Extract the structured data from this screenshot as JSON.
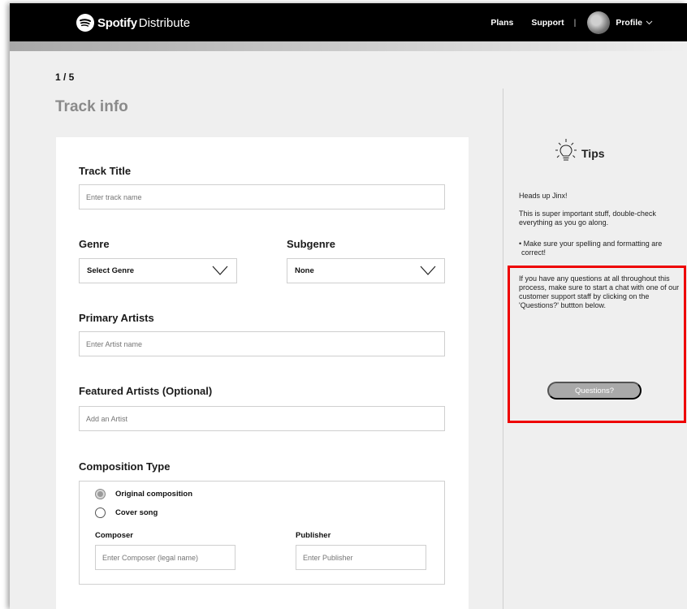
{
  "header": {
    "brand": "Spotify",
    "product": "Distribute",
    "nav": {
      "plans": "Plans",
      "support": "Support",
      "separator": "|",
      "profile": "Profile"
    }
  },
  "progress": {
    "fraction": 0.2
  },
  "step": "1 / 5",
  "page_title": "Track info",
  "form": {
    "track_title": {
      "label": "Track Title",
      "placeholder": "Enter track name"
    },
    "genre": {
      "label": "Genre",
      "value": "Select Genre"
    },
    "subgenre": {
      "label": "Subgenre",
      "value": "None"
    },
    "primary_artists": {
      "label": "Primary Artists",
      "placeholder": "Enter Artist name"
    },
    "featured_artists": {
      "label": "Featured Artists (Optional)",
      "placeholder": "Add an Artist"
    },
    "composition": {
      "label": "Composition Type",
      "options": [
        "Original composition",
        "Cover song"
      ],
      "selected": "Original composition",
      "composer": {
        "label": "Composer",
        "placeholder": "Enter Composer (legal name)"
      },
      "publisher": {
        "label": "Publisher",
        "placeholder": "Enter Publisher"
      }
    }
  },
  "tips": {
    "title": "Tips",
    "greeting": "Heads up Jinx!",
    "intro": "This is super important stuff, double-check everything as you go along.",
    "bullet": "• Make sure your spelling and formatting are correct!",
    "questions_text": "If you have any questions at all throughout this process, make sure to start a chat with one of our customer support staff by clicking on the 'Questions?' buttton below.",
    "button": "Questions?"
  },
  "colors": {
    "header_bg": "#000000",
    "page_bg": "#efefef",
    "highlight": "#ee0000",
    "button_bg": "#a9a9a9"
  }
}
